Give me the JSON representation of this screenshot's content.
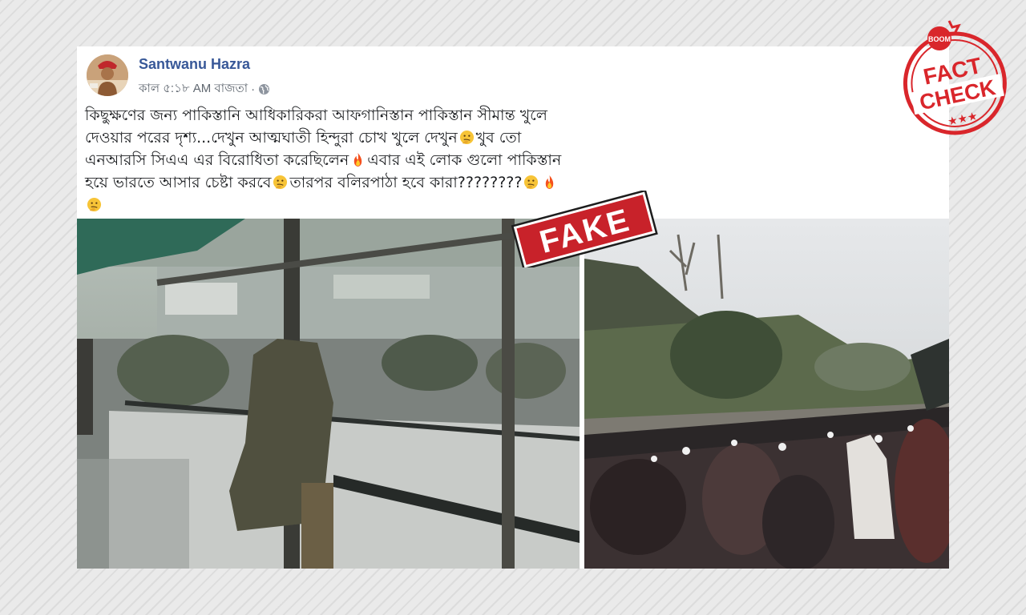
{
  "post": {
    "author": "Santwanu Hazra",
    "time": "কাল ৫:১৮ AM বাজতা",
    "separator": "·",
    "privacy_icon": "globe-icon",
    "text_lines": [
      "কিছুক্ষণের জন্য পাকিস্তানি আধিকারিকরা আফগানিস্তান পাকিস্তান সীমান্ত খুলে",
      "দেওয়ার পরের দৃশ্য...দেখুন আত্মঘাতী হিন্দুরা চোখ খুলে দেখুন",
      "খুব তো",
      "এনআরসি সিএএ এর বিরোধিতা করেছিলেন",
      "এবার এই লোক গুলো পাকিস্তান",
      "হয়ে ভারতে আসার চেষ্টা করবে",
      "তারপর বলিরপাঠা হবে কারা????????"
    ]
  },
  "labels": {
    "fake": "FAKE",
    "stamp_brand": "BOOM",
    "stamp_word1": "FACT",
    "stamp_word2": "CHECK",
    "stamp_stars": "★★★"
  },
  "colors": {
    "author": "#385898",
    "stamp_red": "#d9262b",
    "fake_red": "#c8222a"
  }
}
